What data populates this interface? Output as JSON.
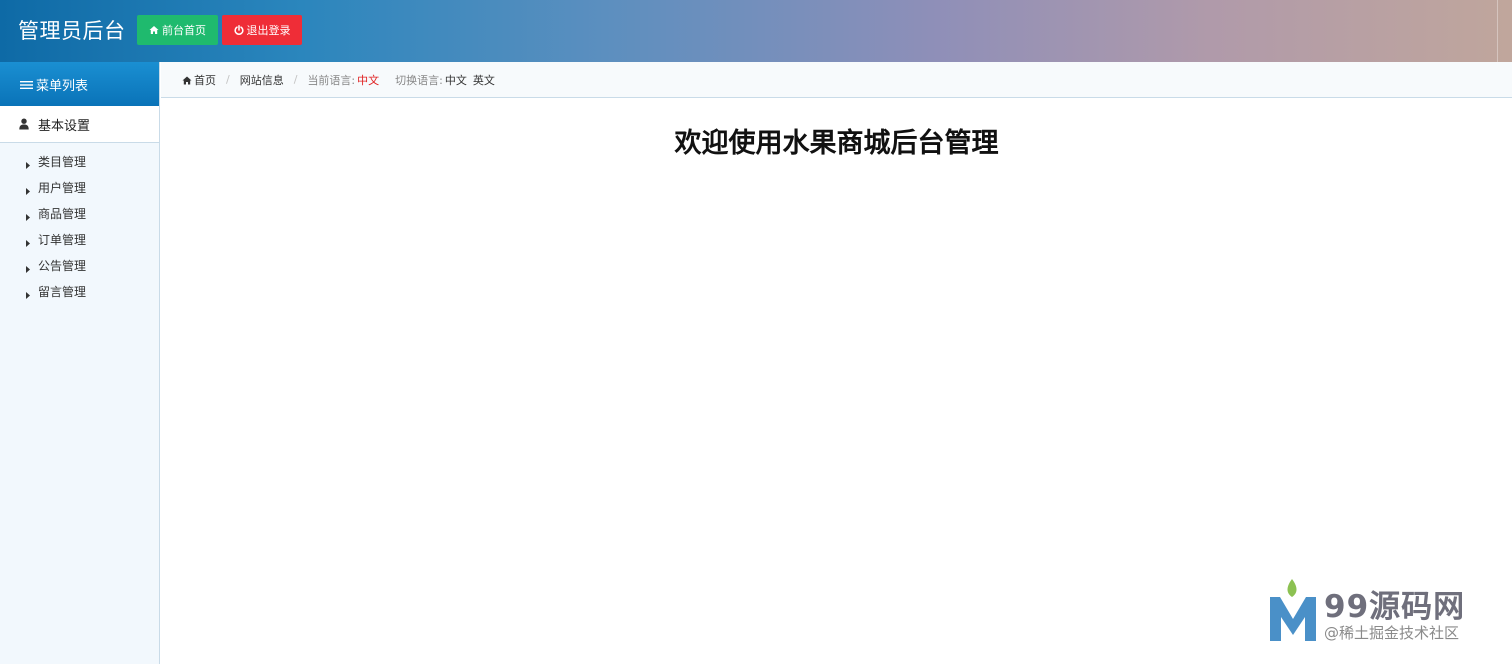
{
  "header": {
    "brand": "管理员后台",
    "home_button": "前台首页",
    "logout_button": "退出登录"
  },
  "sidebar": {
    "title": "菜单列表",
    "group": "基本设置",
    "items": [
      {
        "label": "类目管理"
      },
      {
        "label": "用户管理"
      },
      {
        "label": "商品管理"
      },
      {
        "label": "订单管理"
      },
      {
        "label": "公告管理"
      },
      {
        "label": "留言管理"
      }
    ]
  },
  "breadcrumb": {
    "home": "首页",
    "current": "网站信息",
    "current_lang_label": "当前语言:",
    "current_lang": "中文",
    "switch_lang_label": "切换语言:",
    "lang_options": [
      "中文",
      "英文"
    ]
  },
  "main": {
    "welcome": "欢迎使用水果商城后台管理"
  },
  "watermark": {
    "brand": "99源码网",
    "sub": "@稀土掘金技术社区"
  },
  "colors": {
    "home_button": "#1fba6e",
    "logout_button": "#ef2d37",
    "sidebar_title": "#0a73b8",
    "current_lang": "#e02020"
  }
}
